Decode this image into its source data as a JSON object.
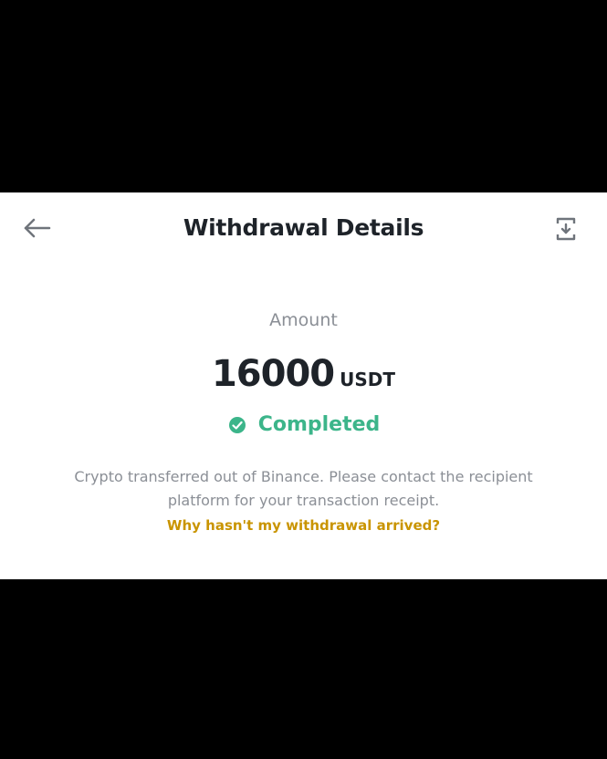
{
  "header": {
    "title": "Withdrawal Details",
    "back_icon": "arrow-left-icon",
    "share_icon": "share-receipt-icon"
  },
  "amount": {
    "label": "Amount",
    "value": "16000",
    "unit": "USDT"
  },
  "status": {
    "icon": "check-circle-icon",
    "text": "Completed",
    "color": "#3cb58a"
  },
  "note": {
    "text": "Crypto transferred out of Binance. Please contact the recipient platform for your transaction receipt.",
    "help_link": "Why hasn't my withdrawal arrived?",
    "link_color": "#c99400"
  }
}
